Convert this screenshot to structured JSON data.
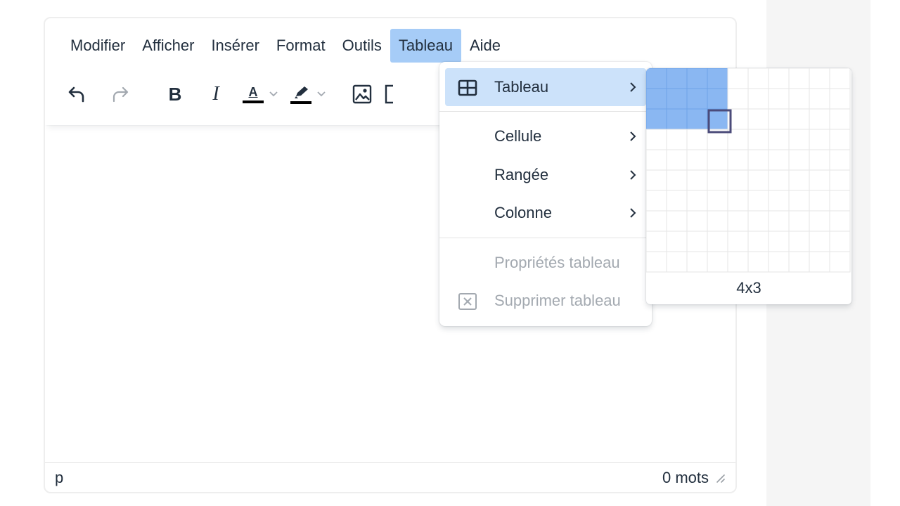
{
  "menubar": {
    "items": [
      {
        "label": "Modifier",
        "active": false
      },
      {
        "label": "Afficher",
        "active": false
      },
      {
        "label": "Insérer",
        "active": false
      },
      {
        "label": "Format",
        "active": false
      },
      {
        "label": "Outils",
        "active": false
      },
      {
        "label": "Tableau",
        "active": true
      },
      {
        "label": "Aide",
        "active": false
      }
    ]
  },
  "toolbar": {
    "bold_glyph": "B",
    "italic_glyph": "I",
    "text_color_glyph": "A"
  },
  "dropdown": {
    "items": [
      {
        "label": "Tableau",
        "icon": "table-icon",
        "has_submenu": true,
        "highlighted": true
      },
      {
        "label": "Cellule",
        "has_submenu": true
      },
      {
        "label": "Rangée",
        "has_submenu": true
      },
      {
        "label": "Colonne",
        "has_submenu": true
      },
      {
        "label": "Propriétés tableau",
        "disabled": true
      },
      {
        "label": "Supprimer tableau",
        "icon": "delete-table-icon",
        "disabled": true
      }
    ]
  },
  "table_grid": {
    "label": "4x3",
    "selected_cols": 4,
    "selected_rows": 3,
    "visible_cols": 10,
    "visible_rows": 10,
    "highlight_color": "#8ab7f2",
    "focus_color": "#4b4b7a"
  },
  "statusbar": {
    "path": "p",
    "word_count": "0 mots"
  },
  "colors": {
    "menu_active_bg": "#a6ccf7",
    "dropdown_hover_bg": "#cce2fa",
    "text": "#222f3e",
    "disabled_text": "#a3a9b0"
  }
}
